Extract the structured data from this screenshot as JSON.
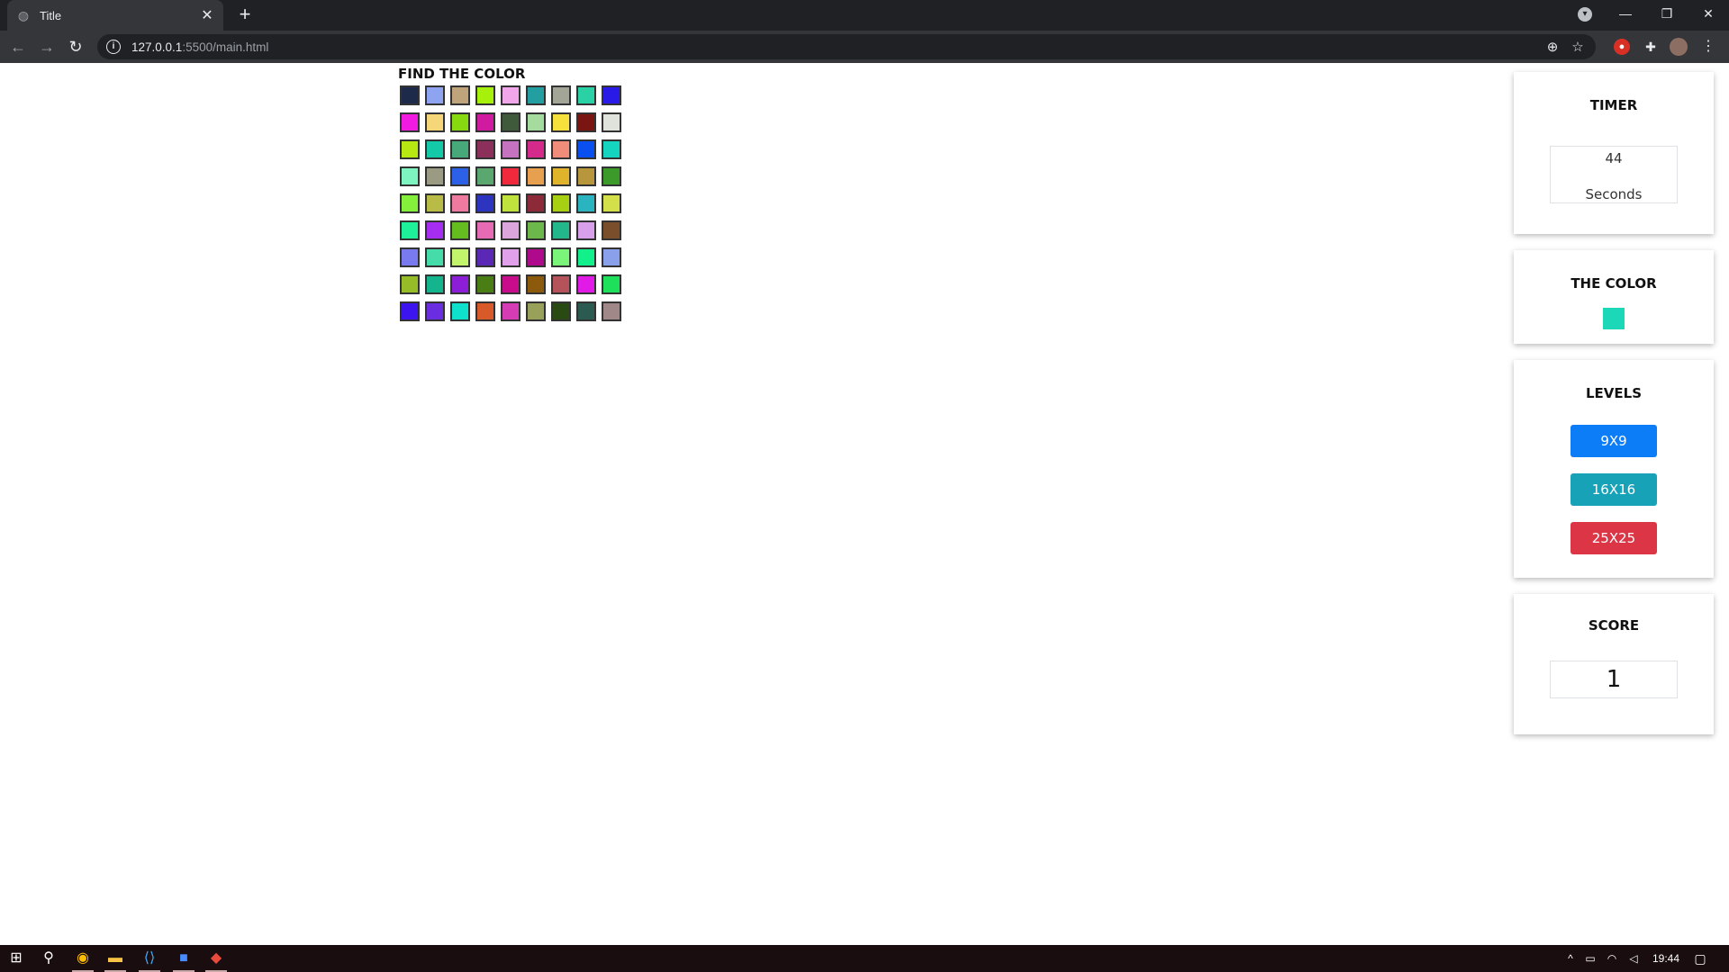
{
  "browser": {
    "tab_title": "Title",
    "url_host": "127.0.0.1",
    "url_path": ":5500/main.html"
  },
  "game": {
    "title": "FIND THE COLOR",
    "grid_colors": [
      [
        "#1e2a4a",
        "#8fa4f0",
        "#bfa37a",
        "#a6f00c",
        "#f0a6e8",
        "#239fa1",
        "#a3a696",
        "#2ad1a4",
        "#2a1ae8"
      ],
      [
        "#f01ae0",
        "#f5d77a",
        "#87d910",
        "#d01aa0",
        "#3f5a3a",
        "#a6dba0",
        "#f5e03c",
        "#7a1512",
        "#dfe3dc"
      ],
      [
        "#b8e812",
        "#14c9a8",
        "#47a87a",
        "#8c2f5a",
        "#c772c0",
        "#d42a8c",
        "#f08c7a",
        "#0a4ff0",
        "#14d4c0"
      ],
      [
        "#7ef5c0",
        "#9a9b82",
        "#2c60e6",
        "#5aa870",
        "#f02a3c",
        "#e6a050",
        "#e0b42a",
        "#b8963c",
        "#3c9a2a"
      ],
      [
        "#84f03c",
        "#b8bc46",
        "#ee7aa0",
        "#2c34c0",
        "#c0e23c",
        "#8c2a3a",
        "#a8d012",
        "#2ab4c0",
        "#d4e04a"
      ],
      [
        "#1ef09a",
        "#a62ef0",
        "#64bc1e",
        "#e66ab4",
        "#dca6dc",
        "#6cb84a",
        "#22b88c",
        "#d8a0ea",
        "#7a4e2a"
      ],
      [
        "#7a7af0",
        "#46dcaa",
        "#c2f56c",
        "#5a28b4",
        "#e0a0ea",
        "#b00a8c",
        "#7af57a",
        "#12f08c",
        "#8aa0ea"
      ],
      [
        "#96bc28",
        "#14b48c",
        "#8c1ed8",
        "#4a7e14",
        "#c80c8c",
        "#8c5a0c",
        "#b4545a",
        "#e21ae8",
        "#1ee05a"
      ],
      [
        "#3c14f0",
        "#6a2ee0",
        "#0ee0cc",
        "#d85a2a",
        "#d63cb4",
        "#98a05a",
        "#2a4a14",
        "#2a5a50",
        "#a08888"
      ]
    ]
  },
  "timer": {
    "title": "TIMER",
    "value": "44",
    "unit": "Seconds"
  },
  "target": {
    "title": "THE COLOR",
    "color": "#1dd8b8"
  },
  "levels": {
    "title": "LEVELS",
    "buttons": [
      {
        "label": "9X9",
        "color": "#0d7df7"
      },
      {
        "label": "16X16",
        "color": "#17a2b8"
      },
      {
        "label": "25X25",
        "color": "#dc3545"
      }
    ]
  },
  "score": {
    "title": "SCORE",
    "value": "1"
  },
  "taskbar": {
    "clock": "19:44"
  }
}
